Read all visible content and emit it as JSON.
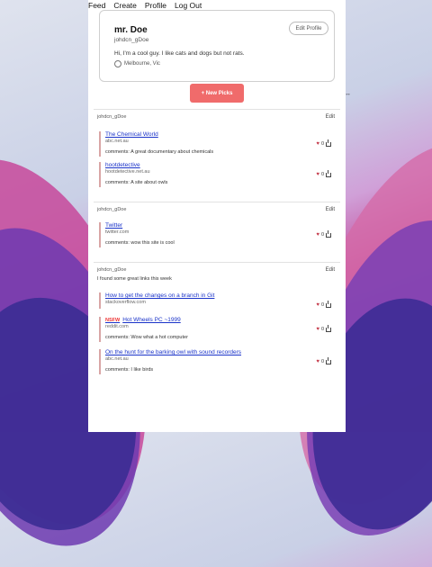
{
  "nav": {
    "items": [
      "Feed",
      "Create",
      "Profile",
      "Log Out"
    ]
  },
  "profile": {
    "name": "mr. Doe",
    "handle": "johdcn_gDoe",
    "bio": "Hi, I'm a cool guy. I like cats and dogs but not rats.",
    "location": "Melbourne, Vic",
    "edit_label": "Edit Profile"
  },
  "new_picks_label": "+ New Picks",
  "groups": [
    {
      "user": "johdcn_gDoe",
      "edit": "Edit",
      "description": "",
      "links": [
        {
          "nsfw": "",
          "title": "The Chemical World",
          "domain": "abc.net.au",
          "comment": "comments: A great documentary about chemicals",
          "likes": "0"
        },
        {
          "nsfw": "",
          "title": "hootdetective",
          "domain": "hootdetective.net.au",
          "comment": "comments: A site about owls",
          "likes": "0"
        }
      ]
    },
    {
      "user": "johdcn_gDoe",
      "edit": "Edit",
      "description": "",
      "links": [
        {
          "nsfw": "",
          "title": "Twitter",
          "domain": "twitter.com",
          "comment": "comments: wow this site is cool",
          "likes": "0"
        }
      ]
    },
    {
      "user": "johdcn_gDoe",
      "edit": "Edit",
      "description": "I found some great links this week",
      "links": [
        {
          "nsfw": "",
          "title": "How to get the changes on a branch in Git",
          "domain": "stackoverflow.com",
          "comment": "",
          "likes": "0"
        },
        {
          "nsfw": "NSFW",
          "title": "Hot Wheels PC ~1999",
          "domain": "reddit.com",
          "comment": "comments: Wow what a hot computer",
          "likes": "0"
        },
        {
          "nsfw": "",
          "title": "On the hunt for the barking owl with sound recorders",
          "domain": "abc.net.au",
          "comment": "comments: I like birds",
          "likes": "0"
        }
      ]
    }
  ],
  "colors": {
    "accent": "#f06b6b",
    "link": "#1a33c9",
    "heart": "#c53a4a"
  },
  "icons": {
    "location": "location-pin-icon",
    "like": "heart-icon",
    "share": "share-icon"
  }
}
